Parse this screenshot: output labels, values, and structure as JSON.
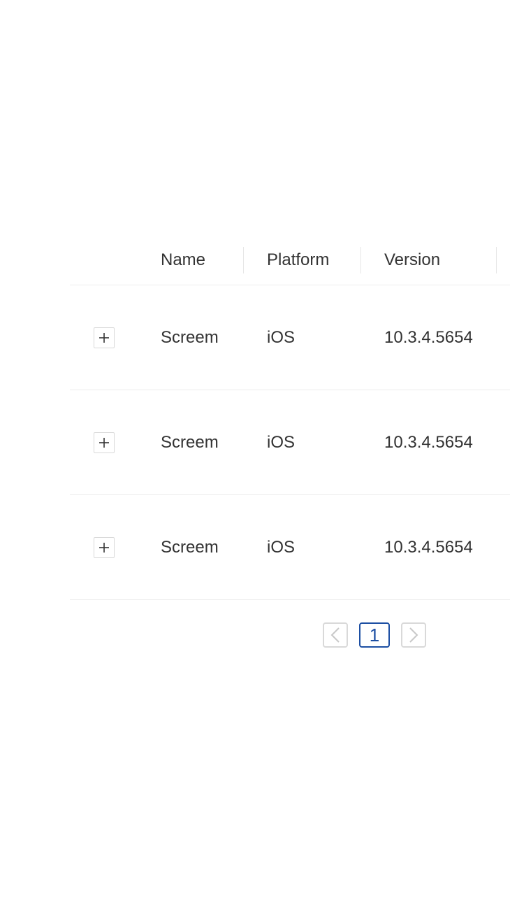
{
  "table": {
    "columns": [
      "Name",
      "Platform",
      "Version"
    ],
    "rows": [
      {
        "name": "Screem",
        "platform": "iOS",
        "version": "10.3.4.5654"
      },
      {
        "name": "Screem",
        "platform": "iOS",
        "version": "10.3.4.5654"
      },
      {
        "name": "Screem",
        "platform": "iOS",
        "version": "10.3.4.5654"
      }
    ]
  },
  "pagination": {
    "current_page": "1",
    "prev_icon": "chevron-left-icon",
    "next_icon": "chevron-right-icon"
  },
  "icons": {
    "expand": "plus-icon"
  },
  "colors": {
    "accent": "#1d4fa3",
    "border": "#ececec",
    "text": "#333333"
  }
}
